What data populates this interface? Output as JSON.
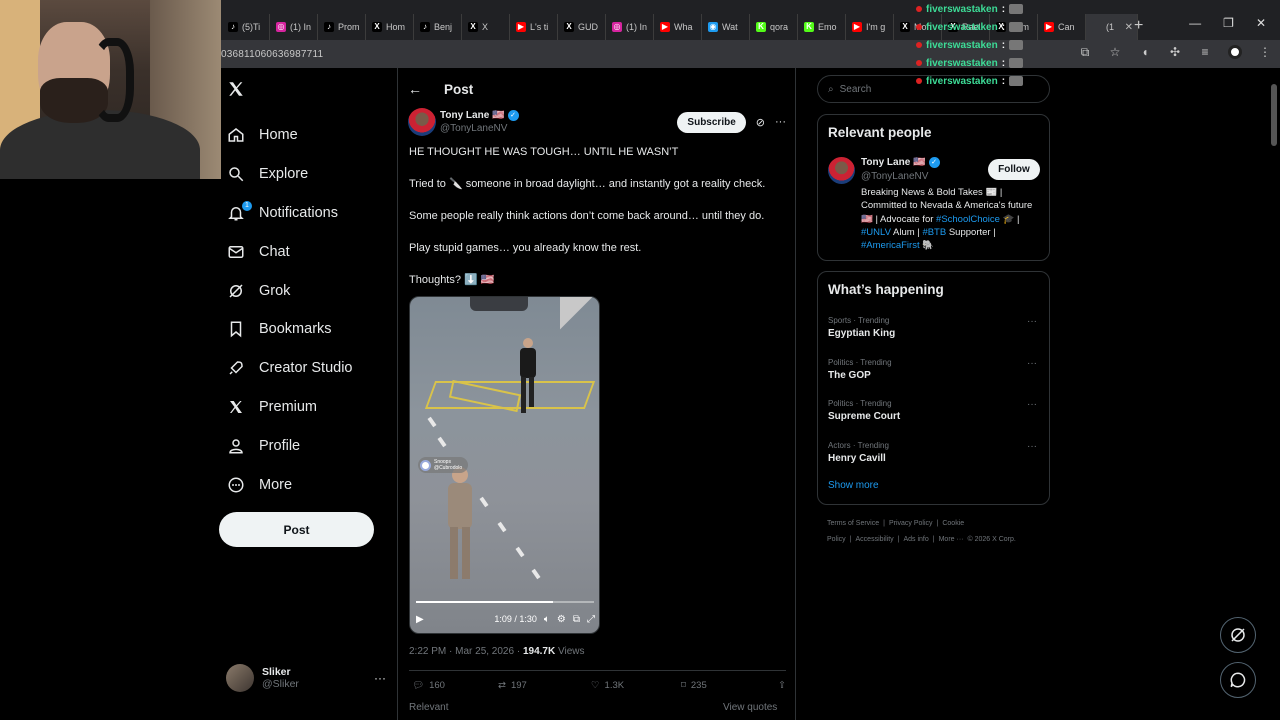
{
  "browser": {
    "tabs": [
      {
        "label": "(5)Ti",
        "fav": "♪",
        "color": "#000000"
      },
      {
        "label": "(1) In",
        "fav": "◎",
        "color": "#d6249f"
      },
      {
        "label": "Prom",
        "fav": "♪",
        "color": "#000000"
      },
      {
        "label": "Hom",
        "fav": "X",
        "color": "#000000"
      },
      {
        "label": "Benj",
        "fav": "♪",
        "color": "#000000"
      },
      {
        "label": "X",
        "fav": "X",
        "color": "#000000"
      },
      {
        "label": "L's ti",
        "fav": "▶",
        "color": "#ff0000"
      },
      {
        "label": "GUD",
        "fav": "X",
        "color": "#000000"
      },
      {
        "label": "(1) In",
        "fav": "◎",
        "color": "#d6249f"
      },
      {
        "label": "Wha",
        "fav": "▶",
        "color": "#ff0000"
      },
      {
        "label": "Wat",
        "fav": "◉",
        "color": "#1d9bf0"
      },
      {
        "label": "qora",
        "fav": "K",
        "color": "#53fc18"
      },
      {
        "label": "Emo",
        "fav": "K",
        "color": "#53fc18"
      },
      {
        "label": "I'm g",
        "fav": "▶",
        "color": "#ff0000"
      },
      {
        "label": "Moh",
        "fav": "X",
        "color": "#000000"
      },
      {
        "label": "Rael",
        "fav": "X",
        "color": "#000000"
      },
      {
        "label": "Hom",
        "fav": "X",
        "color": "#000000"
      },
      {
        "label": "Can",
        "fav": "▶",
        "color": "#ff0000"
      },
      {
        "label": "(1",
        "fav": "",
        "color": "#35363a",
        "active": true
      }
    ],
    "url": "036811060636987711"
  },
  "chat_overlay": {
    "username": "fiverswastaken",
    "lines": [
      "fiverswastaken",
      "fiverswastaken",
      "fiverswastaken",
      "fiverswastaken",
      "fiverswastaken"
    ]
  },
  "nav": {
    "items": [
      {
        "label": "Home",
        "icon": "home-icon"
      },
      {
        "label": "Explore",
        "icon": "search-icon"
      },
      {
        "label": "Notifications",
        "icon": "bell-icon"
      },
      {
        "label": "Chat",
        "icon": "mail-icon"
      },
      {
        "label": "Grok",
        "icon": "grok-icon"
      },
      {
        "label": "Bookmarks",
        "icon": "bookmark-icon"
      },
      {
        "label": "Creator Studio",
        "icon": "rocket-icon"
      },
      {
        "label": "Premium",
        "icon": "x-icon"
      },
      {
        "label": "Profile",
        "icon": "person-icon"
      },
      {
        "label": "More",
        "icon": "more-circle-icon"
      }
    ],
    "notif_badge": "1",
    "post_label": "Post",
    "account": {
      "name": "Sliker",
      "handle": "@Sliker"
    }
  },
  "post": {
    "header_title": "Post",
    "author": {
      "name": "Tony Lane 🇺🇸",
      "handle": "@TonyLaneNV"
    },
    "subscribe_label": "Subscribe",
    "text": [
      "HE THOUGHT HE WAS TOUGH… UNTIL HE WASN’T",
      "Tried to 🔪 someone in broad daylight… and instantly got a reality check.",
      "Some people really think actions don’t come back around… until they do.",
      "Play stupid games… you already know the rest.",
      "Thoughts? ⬇️ 🇺🇸"
    ],
    "video": {
      "time": "1:09 / 1:30",
      "progress": 0.77,
      "watermark_name": "Snoops",
      "watermark_handle": "@Cubrodolo"
    },
    "meta": {
      "time": "2:22 PM · Mar 25, 2026 · ",
      "views": "194.7K",
      "views_label": " Views"
    },
    "stats": {
      "replies": "160",
      "reposts": "197",
      "likes": "1.3K",
      "bookmarks": "235"
    },
    "relevant_label": "Relevant",
    "view_quotes_label": "View quotes"
  },
  "sidebar": {
    "search_placeholder": "Search",
    "relevant_people": {
      "title": "Relevant people",
      "name": "Tony Lane 🇺🇸",
      "handle": "@TonyLaneNV",
      "follow_label": "Follow",
      "bio_parts": [
        {
          "t": "Breaking News & Bold Takes 📰 | Committed to Nevada & America's future 🇺🇸 | Advocate for ",
          "tag": false
        },
        {
          "t": "#SchoolChoice",
          "tag": true
        },
        {
          "t": " 🎓 | ",
          "tag": false
        },
        {
          "t": "#UNLV",
          "tag": true
        },
        {
          "t": " Alum | ",
          "tag": false
        },
        {
          "t": "#BTB",
          "tag": true
        },
        {
          "t": " Supporter | ",
          "tag": false
        },
        {
          "t": "#AmericaFirst",
          "tag": true
        },
        {
          "t": " 🐘",
          "tag": false
        }
      ]
    },
    "whats_happening": {
      "title": "What’s happening",
      "trends": [
        {
          "cat": "Sports · Trending",
          "name": "Egyptian King"
        },
        {
          "cat": "Politics · Trending",
          "name": "The GOP"
        },
        {
          "cat": "Politics · Trending",
          "name": "Supreme Court"
        },
        {
          "cat": "Actors · Trending",
          "name": "Henry Cavill"
        }
      ],
      "show_more": "Show more"
    },
    "footer": [
      "Terms of Service",
      "|",
      "Privacy Policy",
      "|",
      "Cookie Policy",
      "|",
      "Accessibility",
      "|",
      "Ads info",
      "|",
      "More ···",
      "© 2026 X Corp."
    ]
  }
}
